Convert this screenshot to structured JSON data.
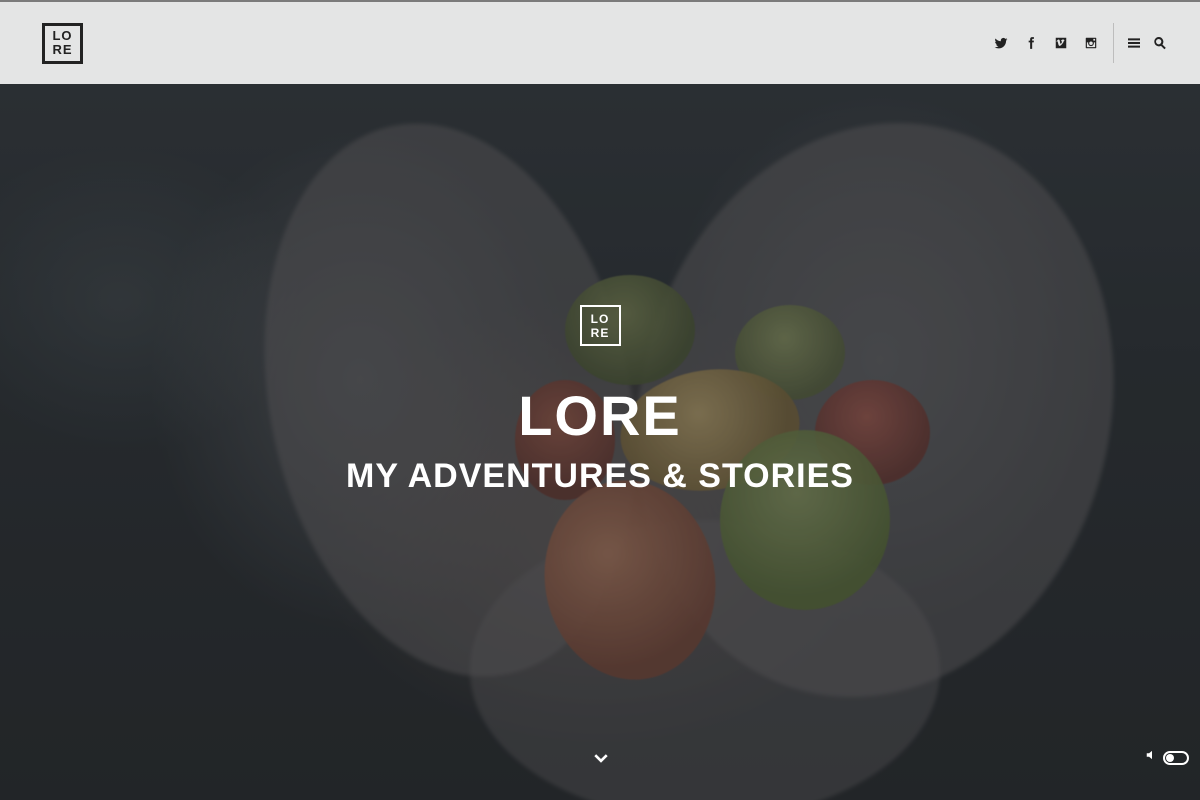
{
  "site": {
    "logo_line1": "LO",
    "logo_line2": "RE"
  },
  "header": {
    "social_icons": [
      "twitter-icon",
      "facebook-icon",
      "vimeo-icon",
      "instagram-icon"
    ],
    "tool_icons": [
      "menu-icon",
      "search-icon"
    ],
    "background_color": "#ececec"
  },
  "hero": {
    "logo_line1": "LO",
    "logo_line2": "RE",
    "title": "LORE",
    "subtitle": "MY ADVENTURES & STORIES",
    "scroll_icon": "chevron-down-icon",
    "sound_icon": "speaker-icon",
    "sound_toggle_state": "off"
  }
}
